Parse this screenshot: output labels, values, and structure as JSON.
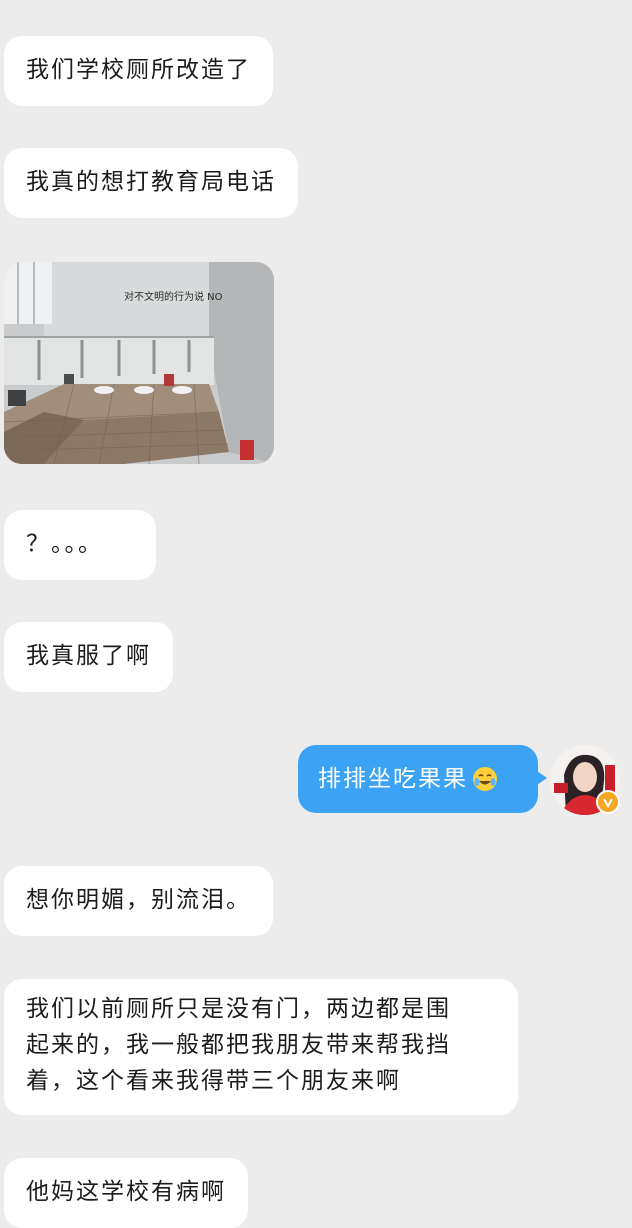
{
  "messages": [
    {
      "id": "m1",
      "side": "left",
      "text": "我们学校厕所改造了"
    },
    {
      "id": "m2",
      "side": "left",
      "text": "我真的想打教育局电话"
    },
    {
      "id": "m3",
      "side": "left",
      "type": "image",
      "sign_text": "对不文明的行为说 NO"
    },
    {
      "id": "m4",
      "side": "left",
      "text": "？。。。"
    },
    {
      "id": "m5",
      "side": "left",
      "text": "我真服了啊"
    },
    {
      "id": "m6",
      "side": "right",
      "text": "排排坐吃果果",
      "emoji": "crying-laughing-emoji"
    },
    {
      "id": "m7",
      "side": "left",
      "text": "想你明媚，别流泪。"
    },
    {
      "id": "m8",
      "side": "left",
      "lines": [
        "我们以前厕所只是没有门，两边都是围",
        "起来的，我一般都把我朋友带来帮我挡",
        "着，这个看来我得带三个朋友来啊"
      ]
    },
    {
      "id": "m9",
      "side": "left",
      "text": "他妈这学校有病啊"
    }
  ],
  "colors": {
    "background": "#ececec",
    "incoming_bubble": "#ffffff",
    "outgoing_bubble": "#3ba2f4",
    "verified_badge": "#f5a623"
  },
  "icons": {
    "verified_badge": "verified-badge-icon",
    "avatar": "user-avatar"
  }
}
